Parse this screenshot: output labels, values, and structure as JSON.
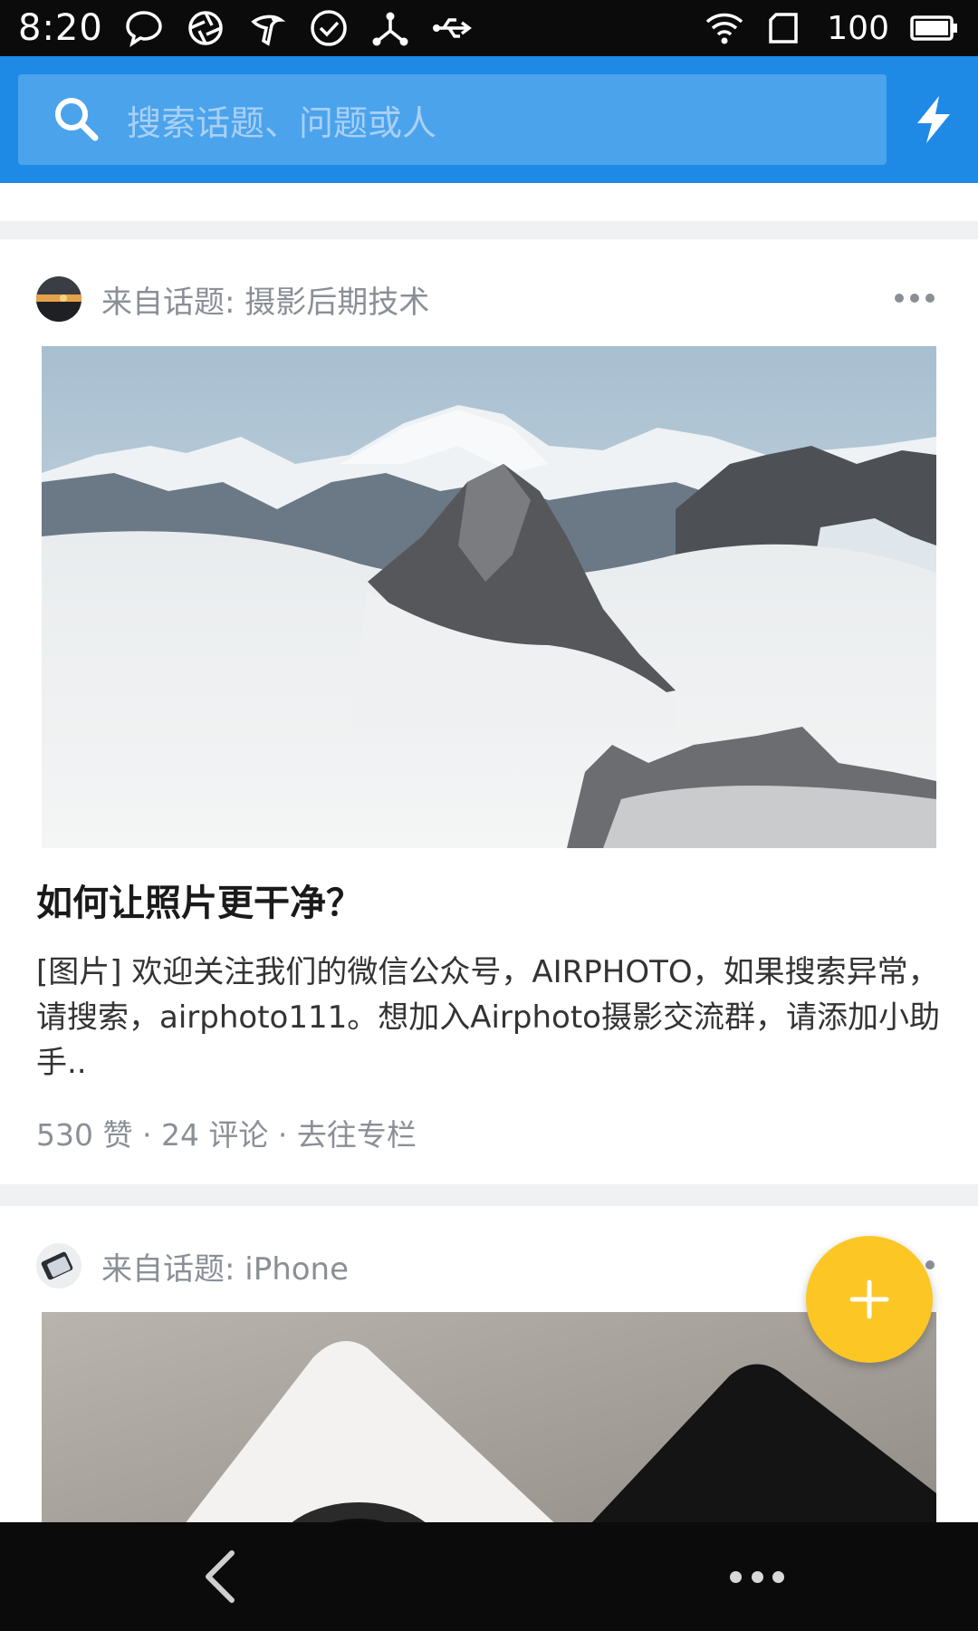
{
  "status_bar": {
    "time": "8:20",
    "battery": "100",
    "icons": [
      "chat-bubble-icon",
      "aperture-icon",
      "bird-icon",
      "check-circle-icon",
      "share-node-icon",
      "usb-icon",
      "wifi-icon",
      "sim-card-icon",
      "battery-icon"
    ]
  },
  "search": {
    "placeholder": "搜索话题、问题或人"
  },
  "colors": {
    "app_bar": "#1e8ae6",
    "search_box": "#4ba3ec",
    "fab": "#fcc624",
    "meta_text": "#8a8f96"
  },
  "feed": [
    {
      "topic_label": "来自话题: 摄影后期技术",
      "title": "如何让照片更干净？",
      "excerpt": "[图片] 欢迎关注我们的微信公众号，AIRPHOTO，如果搜索异常，请搜索，airphoto111。想加入Airphoto摄影交流群，请添加小助手..",
      "meta": "530 赞 · 24 评论 · 去往专栏"
    },
    {
      "topic_label": "来自话题:  iPhone"
    }
  ]
}
